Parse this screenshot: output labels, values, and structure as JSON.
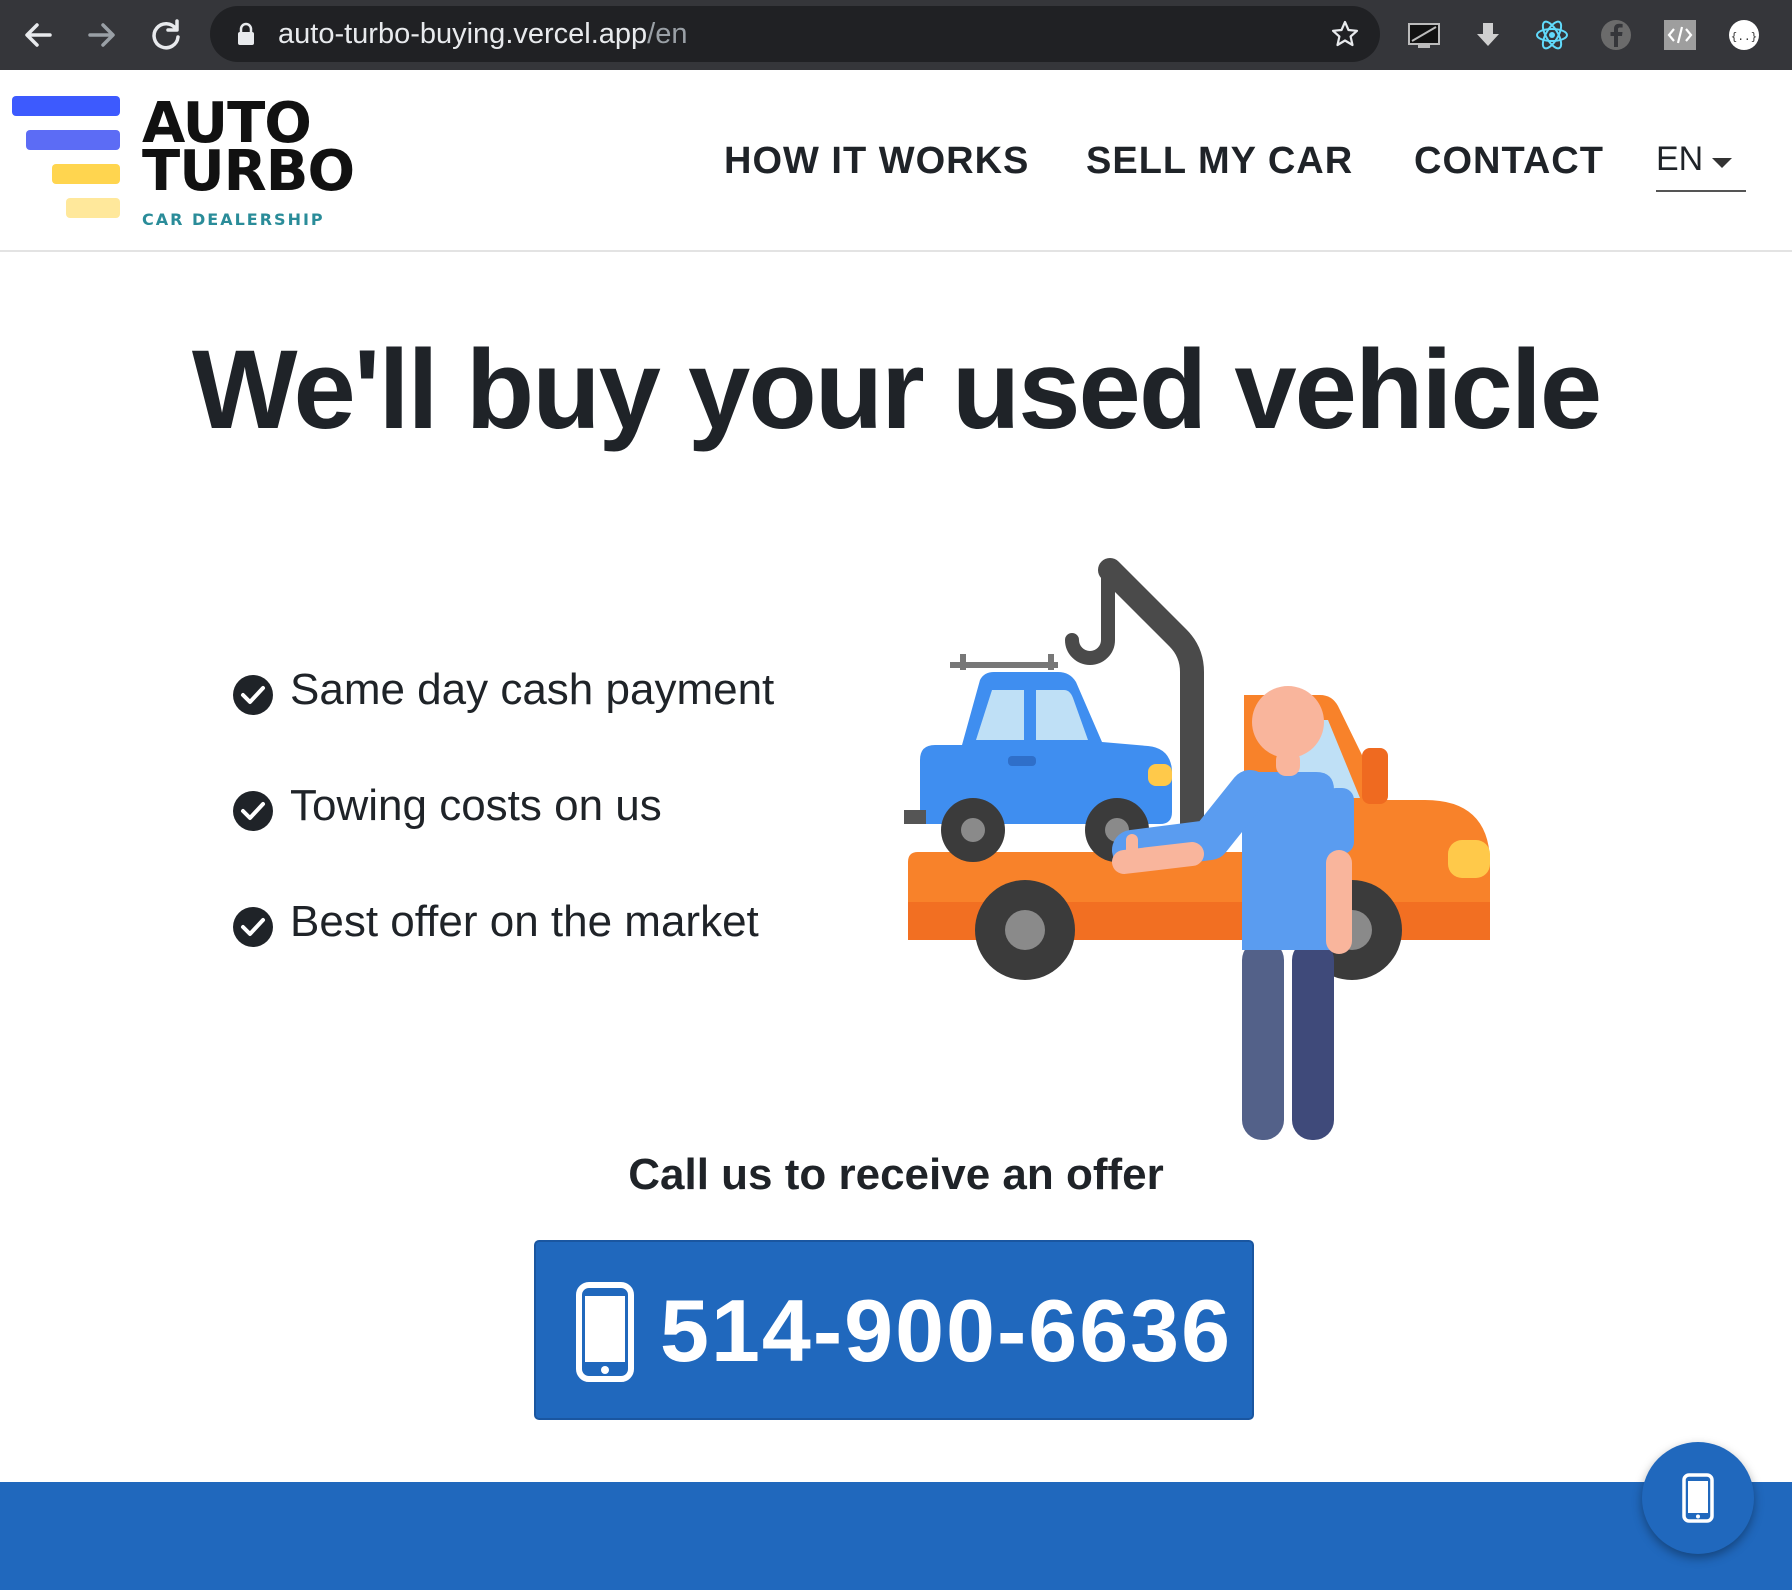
{
  "browser": {
    "url_host": "auto-turbo-buying.vercel.app",
    "url_path": "/en",
    "extensions": [
      "screen-icon",
      "download-icon",
      "react-icon",
      "facebook-icon",
      "code-icon",
      "json-icon"
    ]
  },
  "header": {
    "logo": {
      "line1": "AUTO",
      "line2": "TURBO",
      "subtitle": "CAR DEALERSHIP",
      "colors": {
        "blue": "#3d5afe",
        "yellow": "#ffd54f",
        "teal": "#2a8c99"
      }
    },
    "nav": [
      {
        "label": "HOW IT WORKS"
      },
      {
        "label": "SELL MY CAR"
      },
      {
        "label": "CONTACT"
      }
    ],
    "language": "EN"
  },
  "hero": {
    "title": "We'll buy your used vehicle",
    "features": [
      {
        "icon": "check-circle-icon",
        "text": "Same day cash payment"
      },
      {
        "icon": "check-circle-icon",
        "text": "Towing costs on us"
      },
      {
        "icon": "check-circle-icon",
        "text": "Best offer on the market"
      }
    ],
    "illustration": "tow-truck-illustration"
  },
  "cta": {
    "label": "Call us to receive an offer",
    "phone": "514-900-6636",
    "phone_icon": "smartphone-icon"
  },
  "theme": {
    "primary": "#2068bd",
    "text": "#1f2328"
  }
}
